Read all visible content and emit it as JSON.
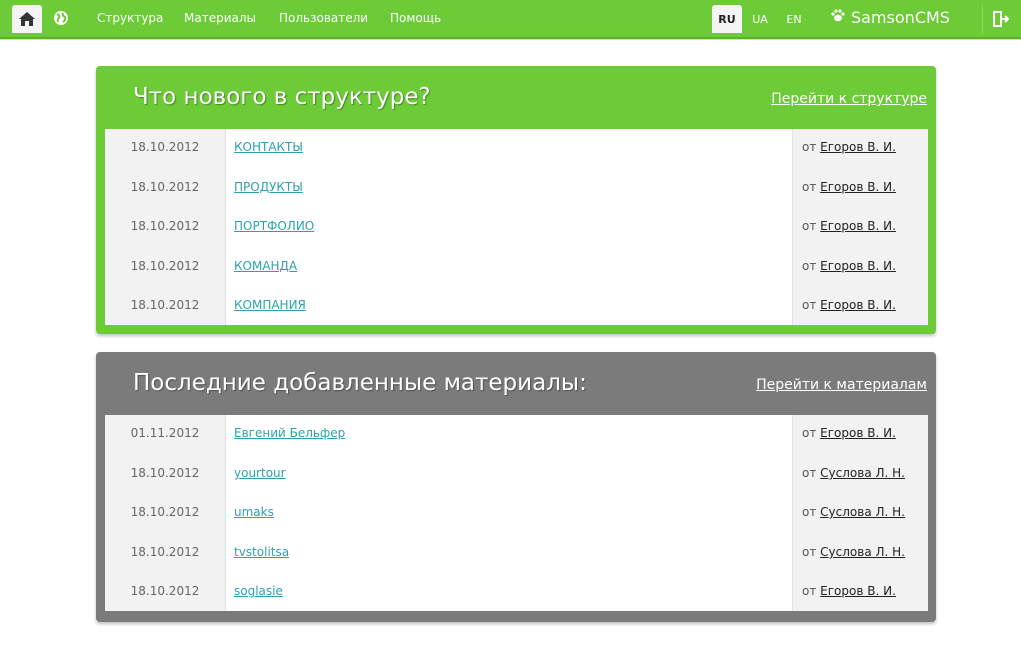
{
  "nav": {
    "items": [
      {
        "label": "Структура"
      },
      {
        "label": "Материалы"
      },
      {
        "label": "Пользователи"
      },
      {
        "label": "Помощь"
      }
    ],
    "languages": [
      "RU",
      "UA",
      "EN"
    ],
    "active_language": "RU",
    "brand": "SamsonCMS"
  },
  "structure_panel": {
    "title": "Что нового в структуре?",
    "link": "Перейти к структуре",
    "author_prefix": "от",
    "rows": [
      {
        "date": "18.10.2012",
        "title": "КОНТАКТЫ",
        "author": "Егоров В. И."
      },
      {
        "date": "18.10.2012",
        "title": "ПРОДУКТЫ",
        "author": "Егоров В. И."
      },
      {
        "date": "18.10.2012",
        "title": "ПОРТФОЛИО",
        "author": "Егоров В. И."
      },
      {
        "date": "18.10.2012",
        "title": "КОМАНДА",
        "author": "Егоров В. И."
      },
      {
        "date": "18.10.2012",
        "title": "КОМПАНИЯ",
        "author": "Егоров В. И."
      }
    ]
  },
  "materials_panel": {
    "title": "Последние добавленные материалы:",
    "link": "Перейти к материалам",
    "author_prefix": "от",
    "rows": [
      {
        "date": "01.11.2012",
        "title": "Евгений Бельфер",
        "author": "Егоров В. И."
      },
      {
        "date": "18.10.2012",
        "title": "yourtour",
        "author": "Суслова Л. Н."
      },
      {
        "date": "18.10.2012",
        "title": "umaks",
        "author": "Суслова Л. Н."
      },
      {
        "date": "18.10.2012",
        "title": "tvstolitsa",
        "author": "Суслова Л. Н."
      },
      {
        "date": "18.10.2012",
        "title": "soglasie",
        "author": "Егоров В. И."
      }
    ]
  },
  "colors": {
    "brand_green": "#6ccb36",
    "panel_gray": "#7b7b7b",
    "link_teal": "#2f9fb0"
  },
  "icons": [
    "home-icon",
    "globe-icon",
    "paw-icon",
    "logout-icon"
  ]
}
